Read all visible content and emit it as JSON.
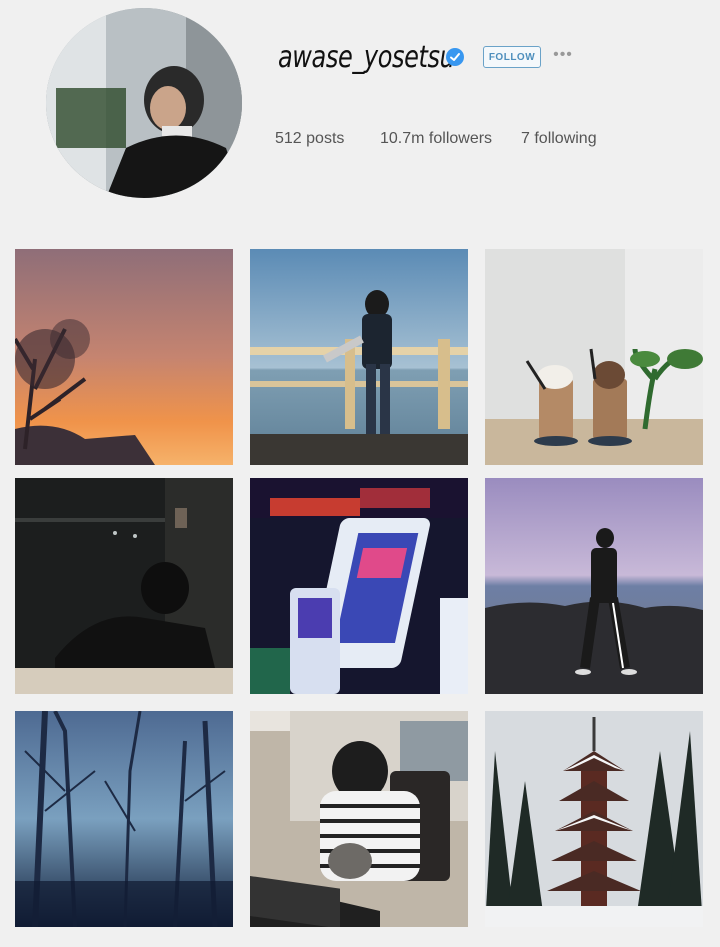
{
  "profile": {
    "username": "awase_yosetsu",
    "follow_label": "FOLLOW",
    "more_label": "•••",
    "posts": "512 posts",
    "followers": "10.7m followers",
    "following": "7 following"
  },
  "colors": {
    "accent": "#3897f0",
    "follow_border": "#6aa2c8"
  },
  "grid": {
    "tiles": [
      {
        "icon": "sunset-tree-photo"
      },
      {
        "icon": "couple-on-pier-photo"
      },
      {
        "icon": "iced-drinks-photo"
      },
      {
        "icon": "dark-room-photo"
      },
      {
        "icon": "arcade-machines-photo"
      },
      {
        "icon": "seaside-walk-photo"
      },
      {
        "icon": "foggy-forest-photo"
      },
      {
        "icon": "cat-desk-photo"
      },
      {
        "icon": "snowy-pagoda-photo"
      }
    ]
  }
}
